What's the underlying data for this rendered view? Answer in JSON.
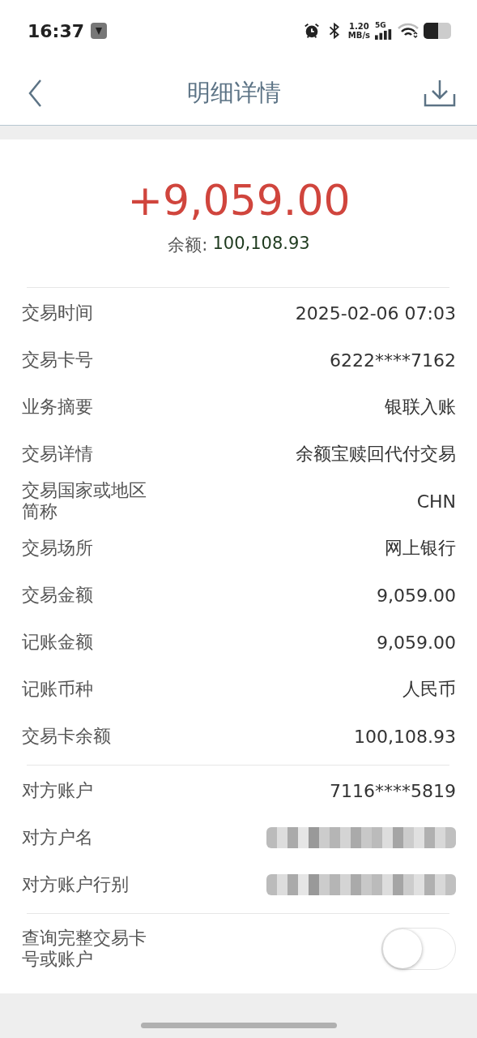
{
  "status_bar": {
    "time": "16:37",
    "speed": [
      "1.20",
      "MB/s"
    ],
    "network": "5G"
  },
  "header": {
    "title": "明细详情"
  },
  "summary": {
    "amount": "+9,059.00",
    "balance_label": "余额:",
    "balance": "100,108.93"
  },
  "groups": [
    {
      "rows": [
        {
          "label": "交易时间",
          "value": "2025-02-06 07:03",
          "kind": "text"
        },
        {
          "label": "交易卡号",
          "value": "6222****7162",
          "kind": "text"
        },
        {
          "label": "业务摘要",
          "value": "银联入账",
          "kind": "text"
        },
        {
          "label": "交易详情",
          "value": "余额宝赎回代付交易",
          "kind": "text"
        },
        {
          "label": "交易国家或地区简称",
          "value": "CHN",
          "kind": "text"
        },
        {
          "label": "交易场所",
          "value": "网上银行",
          "kind": "text"
        },
        {
          "label": "交易金额",
          "value": "9,059.00",
          "kind": "text"
        },
        {
          "label": "记账金额",
          "value": "9,059.00",
          "kind": "text"
        },
        {
          "label": "记账币种",
          "value": "人民币",
          "kind": "text"
        },
        {
          "label": "交易卡余额",
          "value": "100,108.93",
          "kind": "text"
        }
      ]
    },
    {
      "rows": [
        {
          "label": "对方账户",
          "value": "7116****5819",
          "kind": "text"
        },
        {
          "label": "对方户名",
          "kind": "redacted"
        },
        {
          "label": "对方账户行别",
          "kind": "redacted"
        }
      ]
    }
  ],
  "toggle": {
    "label": "查询完整交易卡号或账户",
    "on": false
  }
}
